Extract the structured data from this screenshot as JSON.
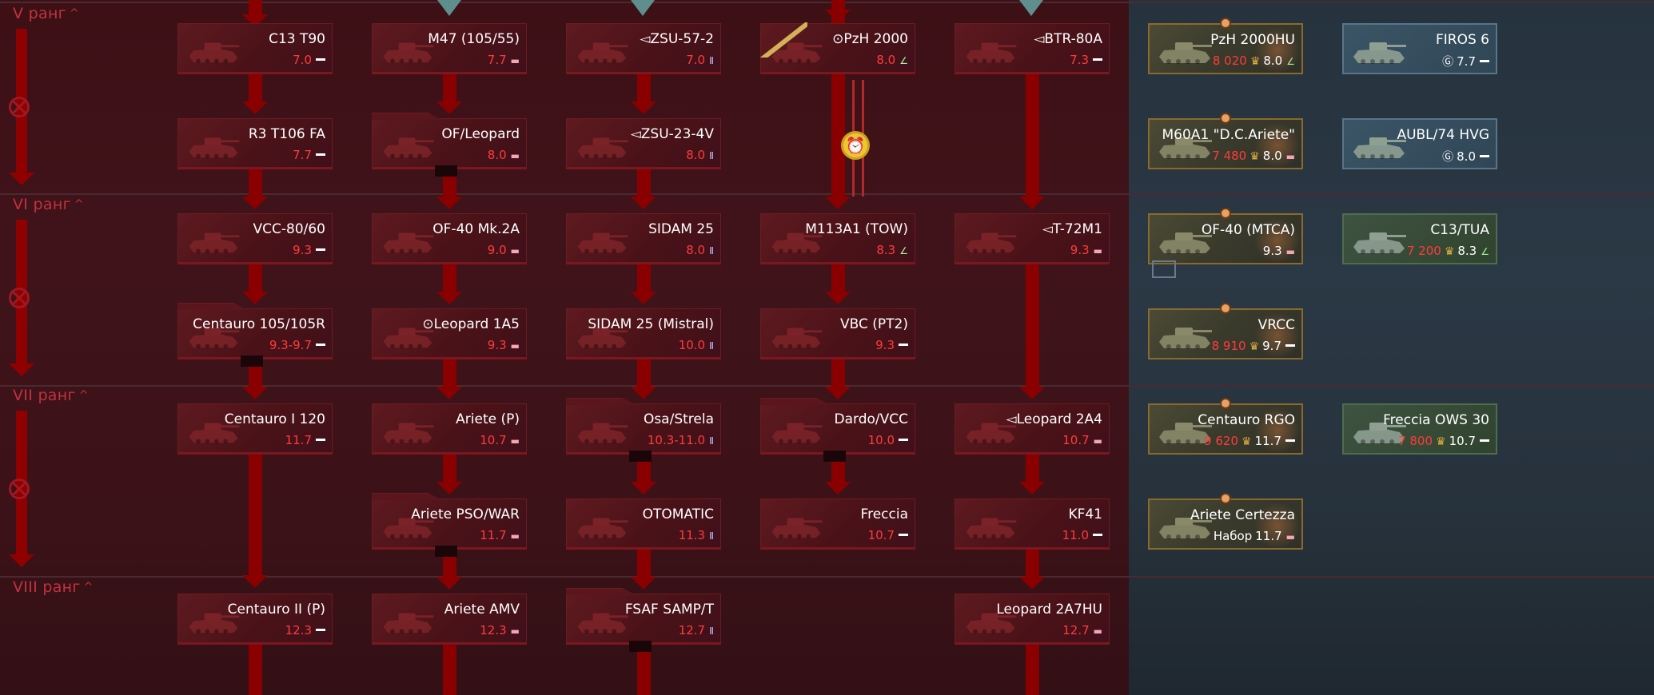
{
  "ranks": [
    {
      "label": "V ранг"
    },
    {
      "label": "VI ранг"
    },
    {
      "label": "VII ранг"
    },
    {
      "label": "VIII ранг"
    }
  ],
  "tree": [
    {
      "name": "C13 T90",
      "br": "7.0",
      "type": "light"
    },
    {
      "name": "M47 (105/55)",
      "br": "7.7",
      "type": "mbt"
    },
    {
      "name": "ZSU-57-2",
      "br": "7.0",
      "type": "spaa",
      "prefix": "◅"
    },
    {
      "name": "PzH 2000",
      "br": "8.0",
      "type": "td",
      "prefix": "⊙"
    },
    {
      "name": "BTR-80A",
      "br": "7.3",
      "type": "light",
      "prefix": "◅"
    },
    {
      "name": "R3 T106 FA",
      "br": "7.7",
      "type": "light"
    },
    {
      "name": "OF/Leopard",
      "br": "8.0",
      "type": "mbt"
    },
    {
      "name": "ZSU-23-4V",
      "br": "8.0",
      "type": "spaa",
      "prefix": "◅"
    },
    {
      "name": "VCC-80/60",
      "br": "9.3",
      "type": "light"
    },
    {
      "name": "OF-40 Mk.2A",
      "br": "9.0",
      "type": "mbt"
    },
    {
      "name": "SIDAM 25",
      "br": "8.0",
      "type": "spaa"
    },
    {
      "name": "M113A1 (TOW)",
      "br": "8.3",
      "type": "td"
    },
    {
      "name": "T-72M1",
      "br": "9.3",
      "type": "mbt",
      "prefix": "◅"
    },
    {
      "name": "Centauro 105/105R",
      "br": "9.3-9.7",
      "type": "light"
    },
    {
      "name": "Leopard 1A5",
      "br": "9.3",
      "type": "mbt",
      "prefix": "⊙"
    },
    {
      "name": "SIDAM 25 (Mistral)",
      "br": "10.0",
      "type": "spaa"
    },
    {
      "name": "VBC (PT2)",
      "br": "9.3",
      "type": "light"
    },
    {
      "name": "Centauro I 120",
      "br": "11.7",
      "type": "light"
    },
    {
      "name": "Ariete (P)",
      "br": "10.7",
      "type": "mbt"
    },
    {
      "name": "Osa/Strela",
      "br": "10.3-11.0",
      "type": "spaa"
    },
    {
      "name": "Dardo/VCC",
      "br": "10.0",
      "type": "light"
    },
    {
      "name": "Leopard 2A4",
      "br": "10.7",
      "type": "mbt",
      "prefix": "◅"
    },
    {
      "name": "Ariete PSO/WAR",
      "br": "11.7",
      "type": "mbt"
    },
    {
      "name": "OTOMATIC",
      "br": "11.3",
      "type": "spaa"
    },
    {
      "name": "Freccia",
      "br": "10.7",
      "type": "light"
    },
    {
      "name": "KF41",
      "br": "11.0",
      "type": "light"
    },
    {
      "name": "Centauro II (P)",
      "br": "12.3",
      "type": "light"
    },
    {
      "name": "Ariete AMV",
      "br": "12.3",
      "type": "mbt"
    },
    {
      "name": "FSAF SAMP/T",
      "br": "12.7",
      "type": "spaa"
    },
    {
      "name": "Leopard 2A7HU",
      "br": "12.7",
      "type": "mbt"
    }
  ],
  "premium": [
    {
      "name": "PzH 2000HU",
      "price": "8 020",
      "br": "8.0",
      "type": "td"
    },
    {
      "name": "FIROS 6",
      "gift": true,
      "br": "7.7",
      "type": "light"
    },
    {
      "name": "M60A1 \"D.C.Ariete\"",
      "price": "7 480",
      "br": "8.0",
      "type": "mbt"
    },
    {
      "name": "AUBL/74 HVG",
      "gift": true,
      "br": "8.0",
      "type": "light"
    },
    {
      "name": "OF-40 (MTCA)",
      "br": "9.3",
      "type": "mbt"
    },
    {
      "name": "C13/TUA",
      "price": "7 200",
      "br": "8.3",
      "type": "td"
    },
    {
      "name": "VRCC",
      "price": "8 910",
      "br": "9.7",
      "type": "light"
    },
    {
      "name": "Centauro RGO",
      "price": "9 620",
      "br": "11.7",
      "type": "light"
    },
    {
      "name": "Freccia OWS 30",
      "price": "7 800",
      "br": "10.7",
      "type": "light"
    },
    {
      "name": "Ariete Certezza",
      "pack": "Набор",
      "br": "11.7",
      "type": "mbt"
    }
  ],
  "icons": {
    "spaa": "Ⅱ",
    "mbt": "▬",
    "td": "∠",
    "eagle": "♛",
    "gift": "Ⓖ",
    "clock": "⏰"
  },
  "colors": {
    "br_red": "#ff3b3b",
    "tree_bg": "#3d1016",
    "premium_bg": "#2b3845"
  }
}
